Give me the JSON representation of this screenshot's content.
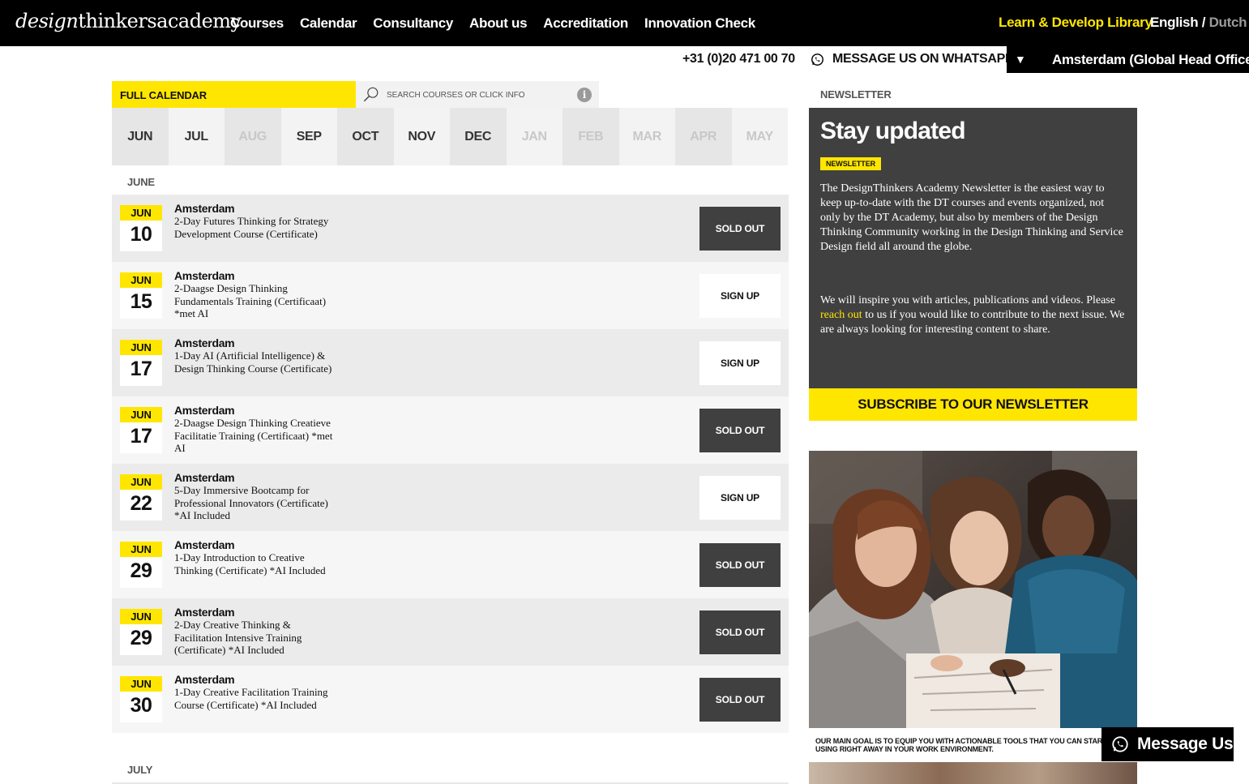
{
  "header": {
    "logo": {
      "italic": "design",
      "rest": "thinkersacademy"
    },
    "nav": [
      "Courses",
      "Calendar",
      "Consultancy",
      "About us",
      "Accreditation",
      "Innovation Check"
    ],
    "library_link": "Learn & Develop Library",
    "language": {
      "english": "English",
      "separator": " / ",
      "dutch": "Dutch"
    }
  },
  "contact_bar": {
    "phone": "+31 (0)20 471 00 70",
    "whatsapp": "MESSAGE US ON WHATSAPP",
    "office": "Amsterdam (Global Head Office)",
    "office_arrow": "▼"
  },
  "calendar": {
    "full_calendar_label": "FULL CALENDAR",
    "search_placeholder": "SEARCH COURSES OR CLICK INFO",
    "info_icon": "i",
    "months": [
      "JUN",
      "JUL",
      "AUG",
      "SEP",
      "OCT",
      "NOV",
      "DEC",
      "JAN",
      "FEB",
      "MAR",
      "APR",
      "MAY"
    ],
    "section_june": "JUNE",
    "section_july": "JULY",
    "events": [
      {
        "month": "JUN",
        "day": "10",
        "city": "Amsterdam",
        "title": "2-Day Futures Thinking for Strategy Development Course (Certificate)",
        "action": "SOLD OUT"
      },
      {
        "month": "JUN",
        "day": "15",
        "city": "Amsterdam",
        "title": "2-Daagse Design Thinking Fundamentals Training (Certificaat) *met AI",
        "action": "SIGN UP"
      },
      {
        "month": "JUN",
        "day": "17",
        "city": "Amsterdam",
        "title": "1-Day AI (Artificial Intelligence) & Design Thinking Course (Certificate)",
        "action": "SIGN UP"
      },
      {
        "month": "JUN",
        "day": "17",
        "city": "Amsterdam",
        "title": "2-Daagse Design Thinking Creatieve Facilitatie Training (Certificaat) *met AI",
        "action": "SOLD OUT"
      },
      {
        "month": "JUN",
        "day": "22",
        "city": "Amsterdam",
        "title": "5-Day Immersive Bootcamp for Professional Innovators (Certificate) *AI Included",
        "action": "SIGN UP"
      },
      {
        "month": "JUN",
        "day": "29",
        "city": "Amsterdam",
        "title": "1-Day Introduction to Creative Thinking (Certificate) *AI Included",
        "action": "SOLD OUT"
      },
      {
        "month": "JUN",
        "day": "29",
        "city": "Amsterdam",
        "title": "2-Day Creative Thinking & Facilitation Intensive Training (Certificate) *AI Included",
        "action": "SOLD OUT"
      },
      {
        "month": "JUN",
        "day": "30",
        "city": "Amsterdam",
        "title": "1-Day Creative Facilitation Training Course (Certificate) *AI Included",
        "action": "SOLD OUT"
      }
    ]
  },
  "newsletter": {
    "label": "NEWSLETTER",
    "heading": "Stay updated",
    "badge": "NEWSLETTER",
    "paragraph1": "The DesignThinkers Academy Newsletter is the easiest way to keep up-to-date with the DT courses and events organized, not only by the DT Academy, but also by members of the Design Thinking Community working in the Design Thinking and Service Design field all around the globe.",
    "paragraph2_before": "We will inspire you with articles, publications and videos. Please ",
    "paragraph2_link": "reach out",
    "paragraph2_after": " to us if you would like to contribute to the next issue. We are always looking for interesting content to share.",
    "subscribe_button": "SUBSCRIBE TO OUR NEWSLETTER"
  },
  "promo": {
    "caption": "OUR MAIN GOAL IS TO EQUIP YOU WITH ACTIONABLE TOOLS THAT YOU CAN START USING RIGHT AWAY IN YOUR WORK ENVIRONMENT."
  },
  "floating": {
    "message_us": "Message Us"
  },
  "colors": {
    "accent": "#ffe600",
    "dark": "#404040",
    "black": "#000000"
  }
}
